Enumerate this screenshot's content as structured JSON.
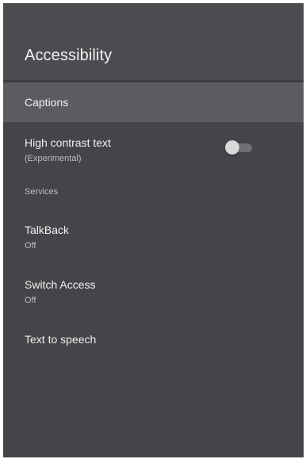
{
  "page": {
    "title": "Accessibility"
  },
  "items": {
    "captions": {
      "title": "Captions"
    },
    "high_contrast": {
      "title": "High contrast text",
      "subtitle": "(Experimental)",
      "enabled": false
    },
    "services_label": "Services",
    "talkback": {
      "title": "TalkBack",
      "subtitle": "Off"
    },
    "switch_access": {
      "title": "Switch Access",
      "subtitle": "Off"
    },
    "tts": {
      "title": "Text to speech"
    }
  },
  "colors": {
    "background": "#444548",
    "header": "#4b4c4f",
    "focused_row": "#5b5c5f",
    "text_primary": "#f0f0f0",
    "text_secondary": "#bdbdbd"
  }
}
